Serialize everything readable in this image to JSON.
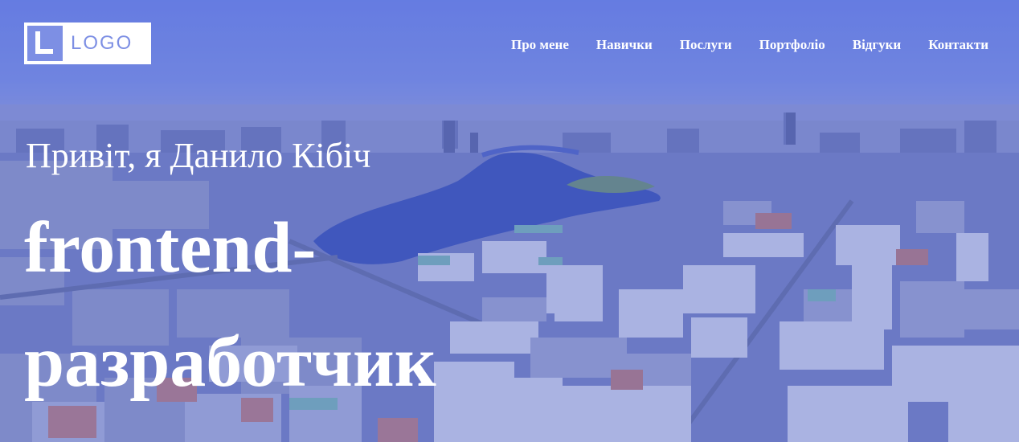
{
  "logo": {
    "text": "LOGO",
    "mark_icon": "logo-l-mark"
  },
  "nav": {
    "items": [
      {
        "label": "Про мене"
      },
      {
        "label": "Навички"
      },
      {
        "label": "Послуги"
      },
      {
        "label": "Портфоліо"
      },
      {
        "label": "Відгуки"
      },
      {
        "label": "Контакти"
      }
    ]
  },
  "hero": {
    "greeting": "Привіт, я Данило Кібіч",
    "title_line1": "frontend-",
    "title_line2": "разработчик",
    "background": "aerial-city-river-photo",
    "accent_color": "#7d8fe4",
    "overlay_color": "#5b6fd6"
  }
}
